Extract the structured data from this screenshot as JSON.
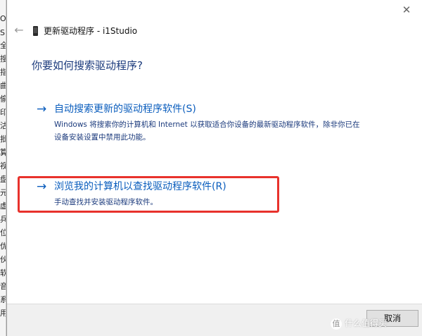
{
  "background_window": {
    "chars": [
      "O",
      "SI",
      "全",
      "搜",
      "指",
      "曲",
      "偷",
      "印",
      "沽",
      "批",
      "算",
      "视",
      "盘",
      "元",
      "虚",
      "兵",
      "位",
      "优",
      "伙",
      "软",
      "音",
      "系",
      "用"
    ]
  },
  "dialog": {
    "title": "更新驱动程序 - i1Studio",
    "question": "你要如何搜索驱动程序?",
    "options": [
      {
        "arrow": "→",
        "heading": "自动搜索更新的驱动程序软件(S)",
        "description": "Windows 将搜索你的计算机和 Internet 以获取适合你设备的最新驱动程序软件，除非你已在设备安装设置中禁用此功能。"
      },
      {
        "arrow": "→",
        "heading": "浏览我的计算机以查找驱动程序软件(R)",
        "description": "手动查找并安装驱动程序软件。"
      }
    ],
    "cancel_label": "取消",
    "close_glyph": "✕",
    "back_glyph": "←"
  },
  "watermark": {
    "badge": "值",
    "text": "什么值得买"
  },
  "colors": {
    "link_blue": "#0a5dbd",
    "heading_navy": "#1b3a7c",
    "highlight_red": "#e8322c"
  }
}
